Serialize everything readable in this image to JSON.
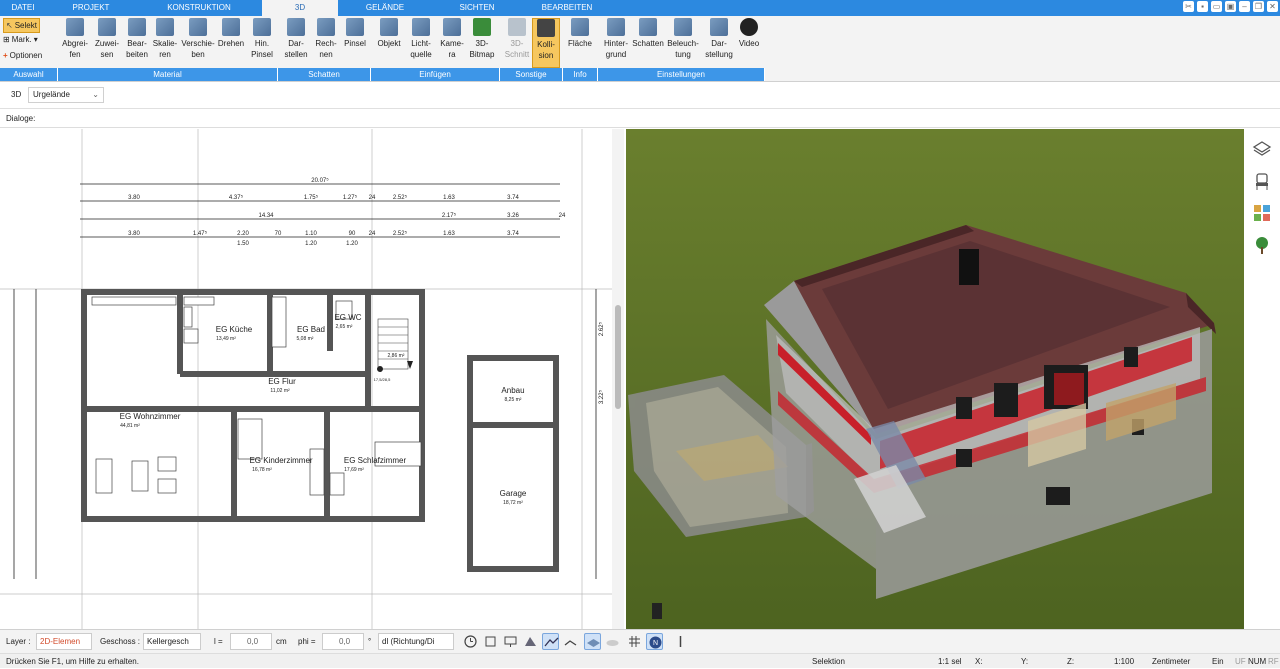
{
  "menu": {
    "tabs": [
      "DATEI",
      "PROJEKT",
      "KONSTRUKTION",
      "3D",
      "GELÄNDE",
      "SICHTEN",
      "BEARBEITEN"
    ],
    "active": "3D"
  },
  "ribbon": {
    "auswahl": {
      "selekt": "Selekt",
      "mark": "Mark.",
      "optionen": "Optionen",
      "group": "Auswahl"
    },
    "material": {
      "group": "Material",
      "buttons": [
        "Abgrei-\nfen",
        "Zuwei-\nsen",
        "Bear-\nbeiten",
        "Skalie-\nren",
        "Verschie-\nben",
        "Drehen",
        "Hin.\nPinsel"
      ]
    },
    "schatten": {
      "group": "Schatten",
      "buttons": [
        "Dar-\nstellen",
        "Rech-\nnen",
        "Pinsel"
      ]
    },
    "einfuegen": {
      "group": "Einfügen",
      "buttons": [
        "Objekt",
        "Licht-\nquelle",
        "Kame-\nra",
        "3D-\nBitmap"
      ]
    },
    "sonstige": {
      "group": "Sonstige",
      "buttons": [
        "3D-\nSchnitt",
        "Kolli-\nsion"
      ]
    },
    "info": {
      "group": "Info",
      "buttons": [
        "Fläche"
      ]
    },
    "einstellungen": {
      "group": "Einstellungen",
      "buttons": [
        "Hinter-\ngrund",
        "Schatten",
        "Beleuch-\ntung",
        "Dar-\nstellung",
        "Video"
      ]
    }
  },
  "bar3d": {
    "label": "3D",
    "select": "Urgelände"
  },
  "dialoge": {
    "label": "Dialoge:"
  },
  "plan": {
    "dims_top": [
      "20.07⁵",
      "3.80",
      "4.37⁵",
      "1.75⁵",
      "1.27⁵",
      "24",
      "2.52⁵",
      "1.63",
      "3.74",
      "14.34",
      "2.17⁵",
      "3.26",
      "24",
      "3.80",
      "1.47⁵",
      "2.20",
      "70",
      "1.10",
      "90",
      "24",
      "2.52⁵",
      "1.63",
      "3.74",
      "1.50",
      "1.20",
      "1.20",
      "2.62⁵",
      "3.22⁵"
    ],
    "rooms": [
      {
        "name": "EG Küche",
        "area": "13,49 m²"
      },
      {
        "name": "EG Bad",
        "area": "5,08 m²"
      },
      {
        "name": "EG WC",
        "area": "2,65 m²"
      },
      {
        "name": "EG Flur",
        "area": "11,02 m²"
      },
      {
        "name": "EG Wohnzimmer",
        "area": "44,81 m²"
      },
      {
        "name": "EG Kinderzimmer",
        "area": "16,78 m²"
      },
      {
        "name": "EG Schlafzimmer",
        "area": "17,69 m²"
      },
      {
        "name": "Anbau",
        "area": "8,25 m²"
      },
      {
        "name": "Garage",
        "area": "18,72 m²"
      }
    ],
    "stair_label": "2,86 m²",
    "stair_sub": "17,5/28,5"
  },
  "status": {
    "layer_label": "Layer :",
    "layer_value": "2D-Elemen",
    "geschoss_label": "Geschoss :",
    "geschoss_value": "Kellergesch",
    "l_label": "l =",
    "l_value": "0,0",
    "l_unit": "cm",
    "phi_label": "phi =",
    "phi_value": "0,0",
    "phi_unit": "°",
    "dl_value": "dl (Richtung/Di"
  },
  "infobar": {
    "help": "Drücken Sie F1, um Hilfe zu erhalten.",
    "mode": "Selektion",
    "scale_sel": "1:1 sel",
    "x": "X:",
    "y": "Y:",
    "z": "Z:",
    "scale": "1:100",
    "unit": "Zentimeter",
    "ein": "Ein",
    "uf": "UF",
    "num": "NUM",
    "rf": "RF"
  },
  "colors": {
    "accent": "#2c89e0",
    "active_tool": "#f6c75f",
    "grass": "#566b26",
    "roof": "#6e3a3a",
    "floor_red": "#c8202a"
  }
}
